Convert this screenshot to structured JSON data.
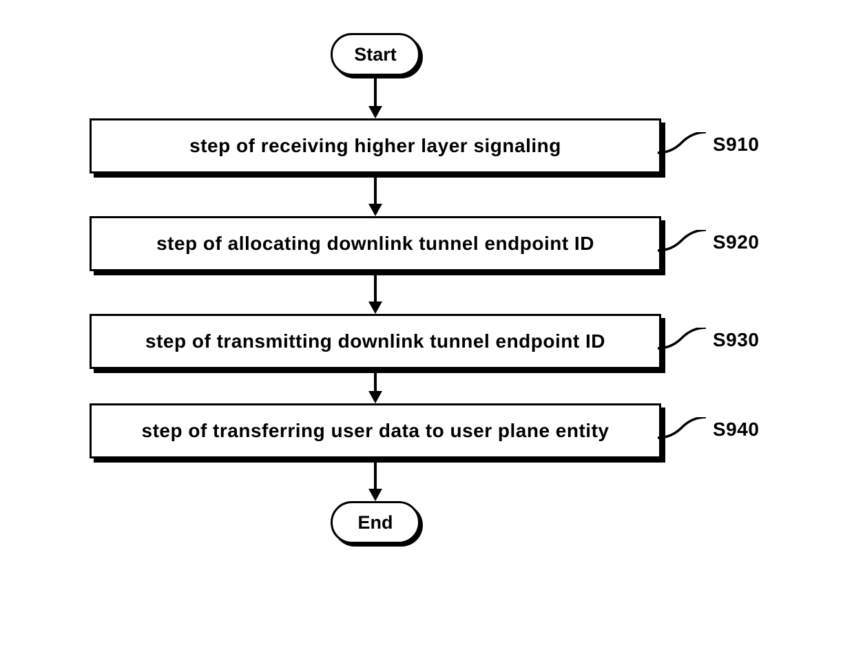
{
  "flow": {
    "start": "Start",
    "end": "End",
    "steps": [
      {
        "text": "step of receiving higher layer signaling",
        "label": "S910"
      },
      {
        "text": "step of allocating downlink tunnel endpoint ID",
        "label": "S920"
      },
      {
        "text": "step of transmitting downlink tunnel endpoint ID",
        "label": "S930"
      },
      {
        "text": "step of transferring user data to user plane entity",
        "label": "S940"
      }
    ]
  }
}
